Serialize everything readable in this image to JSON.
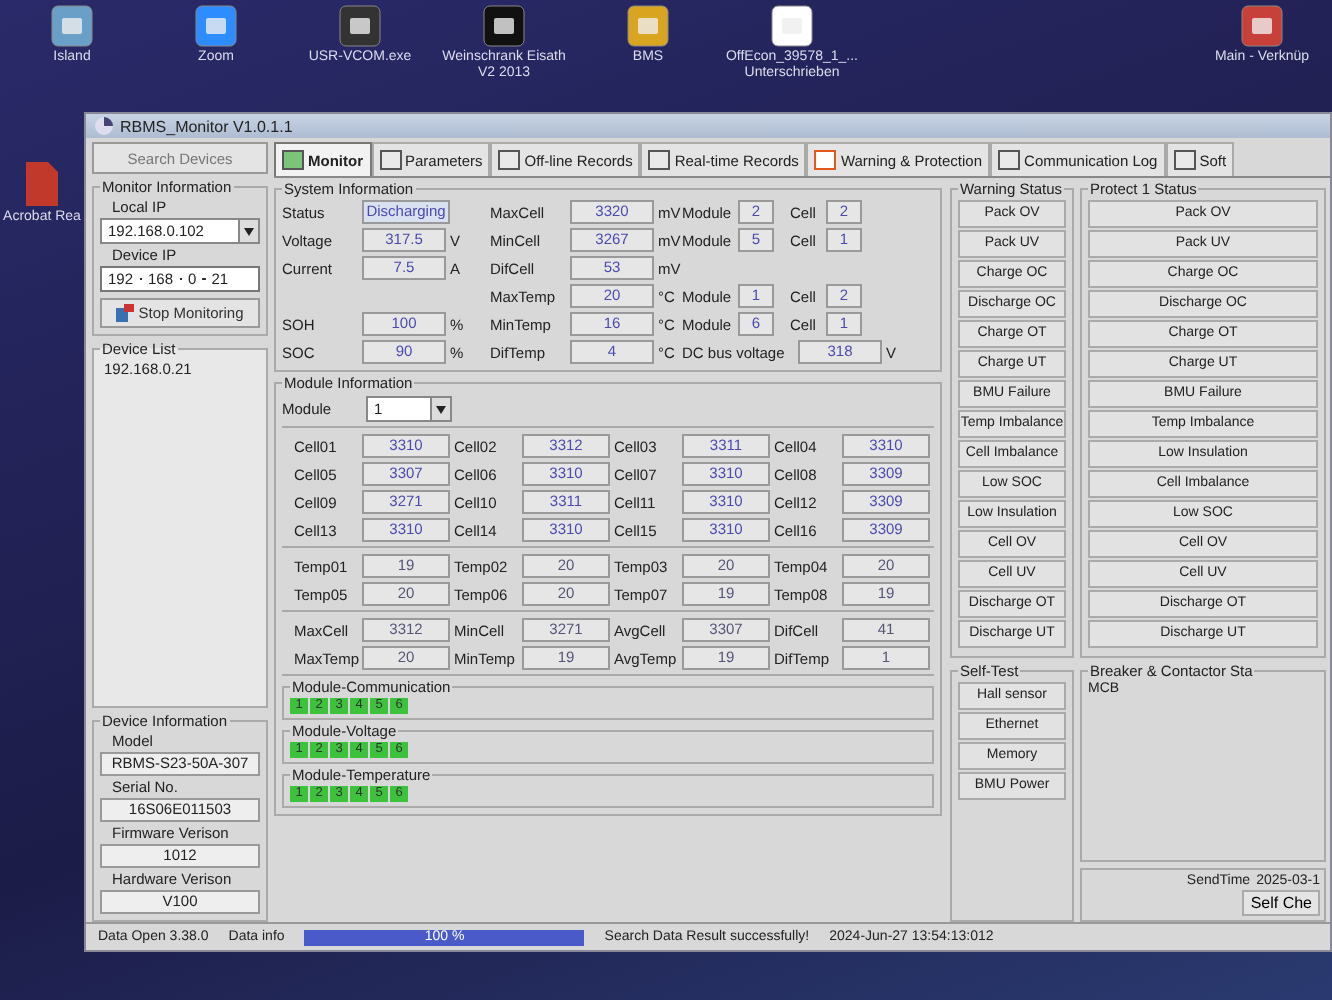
{
  "desktop": {
    "icons": [
      {
        "label": "Island"
      },
      {
        "label": "Zoom"
      },
      {
        "label": "USR-VCOM.exe"
      },
      {
        "label": "Weinschrank Eisath V2 2013"
      },
      {
        "label": "BMS"
      },
      {
        "label": "OffEcon_39578_1_... Unterschrieben"
      },
      {
        "label": "Main - Verknüp"
      }
    ],
    "side_icons": [
      {
        "label": "Acrobat Rea"
      }
    ]
  },
  "window": {
    "title": "RBMS_Monitor V1.0.1.1"
  },
  "tabs": [
    {
      "label": "Monitor",
      "selected": true
    },
    {
      "label": "Parameters",
      "selected": false
    },
    {
      "label": "Off-line Records",
      "selected": false
    },
    {
      "label": "Real-time Records",
      "selected": false
    },
    {
      "label": "Warning & Protection",
      "selected": false
    },
    {
      "label": "Communication Log",
      "selected": false
    },
    {
      "label": "Soft",
      "selected": false
    }
  ],
  "sidebar": {
    "search_button": "Search Devices",
    "monitor_info": {
      "title": "Monitor Information",
      "local_ip_label": "Local IP",
      "local_ip": "192.168.0.102",
      "device_ip_label": "Device IP",
      "device_ip": [
        "192",
        "168",
        "0",
        "21"
      ],
      "stop_button": "Stop Monitoring"
    },
    "device_list": {
      "title": "Device List",
      "items": [
        "192.168.0.21"
      ]
    },
    "device_info": {
      "title": "Device Information",
      "fields": [
        {
          "label": "Model",
          "value": "RBMS-S23-50A-307"
        },
        {
          "label": "Serial No.",
          "value": "16S06E011503"
        },
        {
          "label": "Firmware Verison",
          "value": "1012"
        },
        {
          "label": "Hardware Verison",
          "value": "V100"
        }
      ]
    }
  },
  "system_info": {
    "title": "System Information",
    "rows": [
      {
        "left": {
          "kind": "status",
          "label": "Status",
          "value": "Discharging"
        },
        "mid": {
          "label": "MaxCell",
          "value": "3320",
          "unit": "mV"
        },
        "right": {
          "kind": "location",
          "module_label": "Module",
          "module": "2",
          "cell_label": "Cell",
          "cell": "2"
        }
      },
      {
        "left": {
          "kind": "reading",
          "label": "Voltage",
          "value": "317.5",
          "unit": "V"
        },
        "mid": {
          "label": "MinCell",
          "value": "3267",
          "unit": "mV"
        },
        "right": {
          "kind": "location",
          "module_label": "Module",
          "module": "5",
          "cell_label": "Cell",
          "cell": "1"
        }
      },
      {
        "left": {
          "kind": "reading",
          "label": "Current",
          "value": "7.5",
          "unit": "A"
        },
        "mid": {
          "label": "DifCell",
          "value": "53",
          "unit": "mV"
        }
      },
      {
        "mid": {
          "label": "MaxTemp",
          "value": "20",
          "unit": "°C"
        },
        "right": {
          "kind": "location",
          "module_label": "Module",
          "module": "1",
          "cell_label": "Cell",
          "cell": "2"
        }
      },
      {
        "left": {
          "kind": "reading",
          "label": "SOH",
          "value": "100",
          "unit": "%"
        },
        "mid": {
          "label": "MinTemp",
          "value": "16",
          "unit": "°C"
        },
        "right": {
          "kind": "location",
          "module_label": "Module",
          "module": "6",
          "cell_label": "Cell",
          "cell": "1"
        }
      },
      {
        "left": {
          "kind": "reading",
          "label": "SOC",
          "value": "90",
          "unit": "%"
        },
        "mid": {
          "label": "DifTemp",
          "value": "4",
          "unit": "°C"
        },
        "right": {
          "kind": "reading",
          "label": "DC bus voltage",
          "value": "318",
          "unit": "V"
        }
      }
    ]
  },
  "module_info": {
    "title": "Module Information",
    "module_label": "Module",
    "module": "1",
    "cells": [
      {
        "label": "Cell01",
        "value": "3310"
      },
      {
        "label": "Cell02",
        "value": "3312"
      },
      {
        "label": "Cell03",
        "value": "3311"
      },
      {
        "label": "Cell04",
        "value": "3310"
      },
      {
        "label": "Cell05",
        "value": "3307"
      },
      {
        "label": "Cell06",
        "value": "3310"
      },
      {
        "label": "Cell07",
        "value": "3310"
      },
      {
        "label": "Cell08",
        "value": "3309"
      },
      {
        "label": "Cell09",
        "value": "3271"
      },
      {
        "label": "Cell10",
        "value": "3311"
      },
      {
        "label": "Cell11",
        "value": "3310"
      },
      {
        "label": "Cell12",
        "value": "3309"
      },
      {
        "label": "Cell13",
        "value": "3310"
      },
      {
        "label": "Cell14",
        "value": "3310"
      },
      {
        "label": "Cell15",
        "value": "3310"
      },
      {
        "label": "Cell16",
        "value": "3309"
      }
    ],
    "temps": [
      {
        "label": "Temp01",
        "value": "19"
      },
      {
        "label": "Temp02",
        "value": "20"
      },
      {
        "label": "Temp03",
        "value": "20"
      },
      {
        "label": "Temp04",
        "value": "20"
      },
      {
        "label": "Temp05",
        "value": "20"
      },
      {
        "label": "Temp06",
        "value": "20"
      },
      {
        "label": "Temp07",
        "value": "19"
      },
      {
        "label": "Temp08",
        "value": "19"
      }
    ],
    "stats": [
      {
        "label": "MaxCell",
        "value": "3312"
      },
      {
        "label": "MinCell",
        "value": "3271"
      },
      {
        "label": "AvgCell",
        "value": "3307"
      },
      {
        "label": "DifCell",
        "value": "41"
      },
      {
        "label": "MaxTemp",
        "value": "20"
      },
      {
        "label": "MinTemp",
        "value": "19"
      },
      {
        "label": "AvgTemp",
        "value": "19"
      },
      {
        "label": "DifTemp",
        "value": "1"
      }
    ]
  },
  "module_status": [
    {
      "title": "Module-Communication",
      "modules": [
        {
          "label": "1",
          "on": true
        },
        {
          "label": "2",
          "on": true
        },
        {
          "label": "3",
          "on": true
        },
        {
          "label": "4",
          "on": true
        },
        {
          "label": "5",
          "on": true
        },
        {
          "label": "6",
          "on": true
        }
      ]
    },
    {
      "title": "Module-Voltage",
      "modules": [
        {
          "label": "1",
          "on": true
        },
        {
          "label": "2",
          "on": true
        },
        {
          "label": "3",
          "on": true
        },
        {
          "label": "4",
          "on": true
        },
        {
          "label": "5",
          "on": true
        },
        {
          "label": "6",
          "on": true
        }
      ]
    },
    {
      "title": "Module-Temperature",
      "modules": [
        {
          "label": "1",
          "on": true
        },
        {
          "label": "2",
          "on": true
        },
        {
          "label": "3",
          "on": true
        },
        {
          "label": "4",
          "on": true
        },
        {
          "label": "5",
          "on": true
        },
        {
          "label": "6",
          "on": true
        }
      ]
    }
  ],
  "warning_status": {
    "title": "Warning Status",
    "items": [
      "Pack OV",
      "Pack UV",
      "Charge OC",
      "Discharge OC",
      "Charge OT",
      "Charge UT",
      "BMU Failure",
      "Temp Imbalance",
      "Cell Imbalance",
      "Low SOC",
      "Low Insulation",
      "Cell OV",
      "Cell UV",
      "Discharge OT",
      "Discharge UT"
    ]
  },
  "protect_status": {
    "title": "Protect 1 Status",
    "items": [
      "Pack OV",
      "Pack UV",
      "Charge OC",
      "Discharge OC",
      "Charge OT",
      "Charge UT",
      "BMU Failure",
      "Temp Imbalance",
      "Low Insulation",
      "Cell Imbalance",
      "Low SOC",
      "Cell OV",
      "Cell UV",
      "Discharge OT",
      "Discharge UT"
    ]
  },
  "self_test": {
    "title": "Self-Test",
    "items": [
      "Hall sensor",
      "Ethernet",
      "Memory",
      "BMU Power"
    ]
  },
  "breaker": {
    "title": "Breaker & Contactor Sta",
    "items": [
      "MCB"
    ]
  },
  "send": {
    "label": "SendTime",
    "value": "2025-03-1",
    "button": "Self Che"
  },
  "status_bar": {
    "version": "Data Open 3.38.0",
    "info_label": "Data info",
    "level": 1,
    "progress_text": "100 %",
    "message": "Search Data Result successfully!",
    "timestamp": "2024-Jun-27 13:54:13:012"
  }
}
